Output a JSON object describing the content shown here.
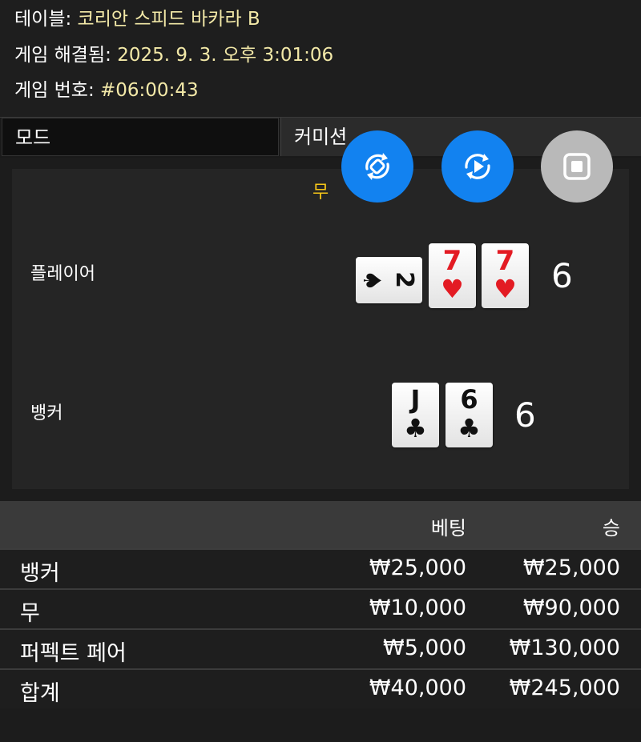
{
  "info": {
    "table_label": "테이블:",
    "table_value": "코리안 스피드 바카라 B",
    "resolved_label": "게임 해결됨:",
    "resolved_value": "2025. 9. 3. 오후 3:01:06",
    "game_no_label": "게임 번호:",
    "game_no_value": "#06:00:43"
  },
  "mode": {
    "left": "모드",
    "right": "커미션"
  },
  "result": "무",
  "player": {
    "label": "플레이어",
    "score": "6",
    "cards": [
      {
        "rank": "2",
        "suit": "♠",
        "color": "black"
      },
      {
        "rank": "7",
        "suit": "♥",
        "color": "red"
      },
      {
        "rank": "7",
        "suit": "♥",
        "color": "red"
      }
    ]
  },
  "banker": {
    "label": "뱅커",
    "score": "6",
    "cards": [
      {
        "rank": "J",
        "suit": "♣",
        "color": "black"
      },
      {
        "rank": "6",
        "suit": "♣",
        "color": "black"
      }
    ]
  },
  "controls": {
    "icons": [
      "sync-icon",
      "replay-icon",
      "stop-icon"
    ],
    "colors": {
      "blue": "#1282f0",
      "gray": "#b9b9b9"
    }
  },
  "bets": {
    "headers": {
      "bet": "베팅",
      "win": "승"
    },
    "rows": [
      {
        "name": "뱅커",
        "bet": "₩25,000",
        "win": "₩25,000"
      },
      {
        "name": "무",
        "bet": "₩10,000",
        "win": "₩90,000"
      },
      {
        "name": "퍼펙트 페어",
        "bet": "₩5,000",
        "win": "₩130,000"
      }
    ],
    "total": {
      "name": "합계",
      "bet": "₩40,000",
      "win": "₩245,000"
    }
  },
  "colors": {
    "accent_gold": "#f5c518",
    "info_value": "#f3e9a8"
  }
}
